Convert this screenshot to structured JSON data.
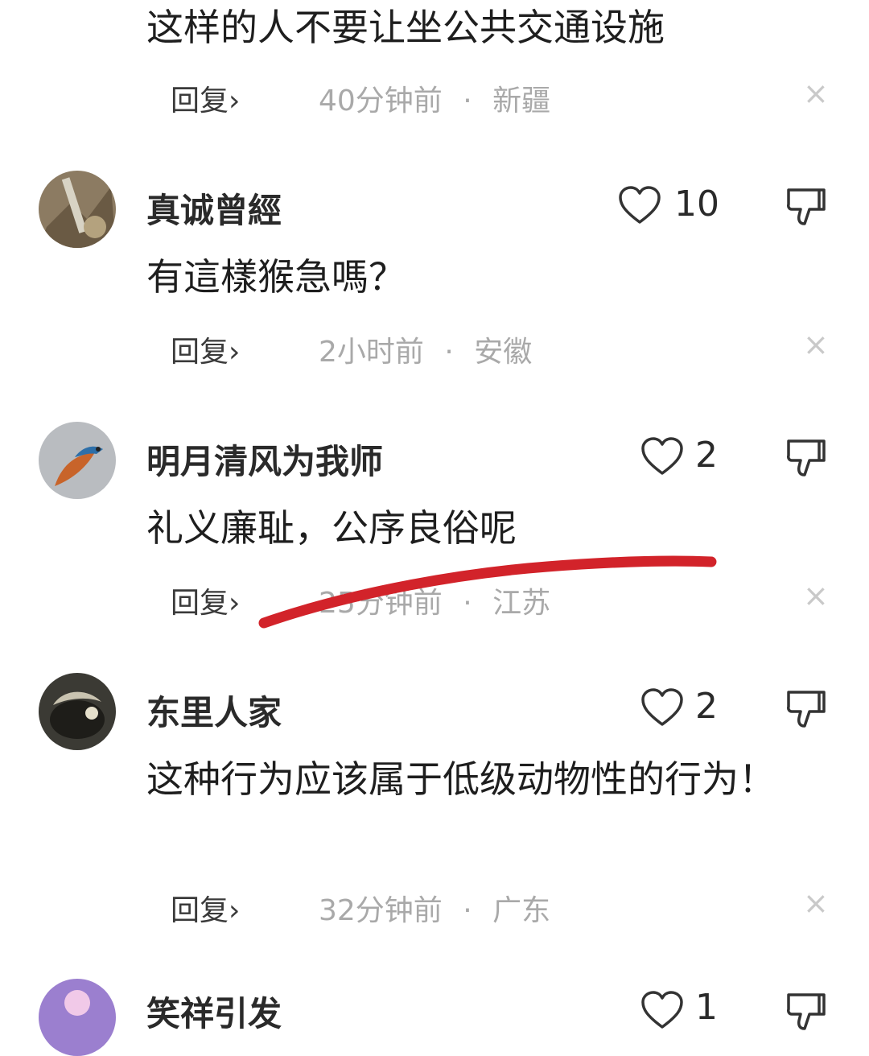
{
  "comments": [
    {
      "text": "这样的人不要让坐公共交通设施",
      "reply_label": "回复",
      "time": "40分钟前",
      "region": "新疆"
    },
    {
      "username": "真诚曾經",
      "likes": "10",
      "text": "有這樣猴急嗎？",
      "reply_label": "回复",
      "time": "2小时前",
      "region": "安徽"
    },
    {
      "username": "明月清风为我师",
      "likes": "2",
      "text": "礼义廉耻，公序良俗呢",
      "reply_label": "回复",
      "time": "25分钟前",
      "region": "江苏"
    },
    {
      "username": "东里人家",
      "likes": "2",
      "text": "这种行为应该属于低级动物性的行为！",
      "reply_label": "回复",
      "time": "32分钟前",
      "region": "广东"
    },
    {
      "username": "笑祥引发",
      "likes": "1"
    }
  ],
  "meta_separator": "·",
  "chevron": "›",
  "close_glyph": "×",
  "icons": {
    "like": "heart-outline-icon",
    "dislike": "thumbs-down-icon",
    "close": "close-icon"
  },
  "colors": {
    "annotation_stroke": "#d2232a",
    "meta_gray": "#a9a9a9"
  }
}
